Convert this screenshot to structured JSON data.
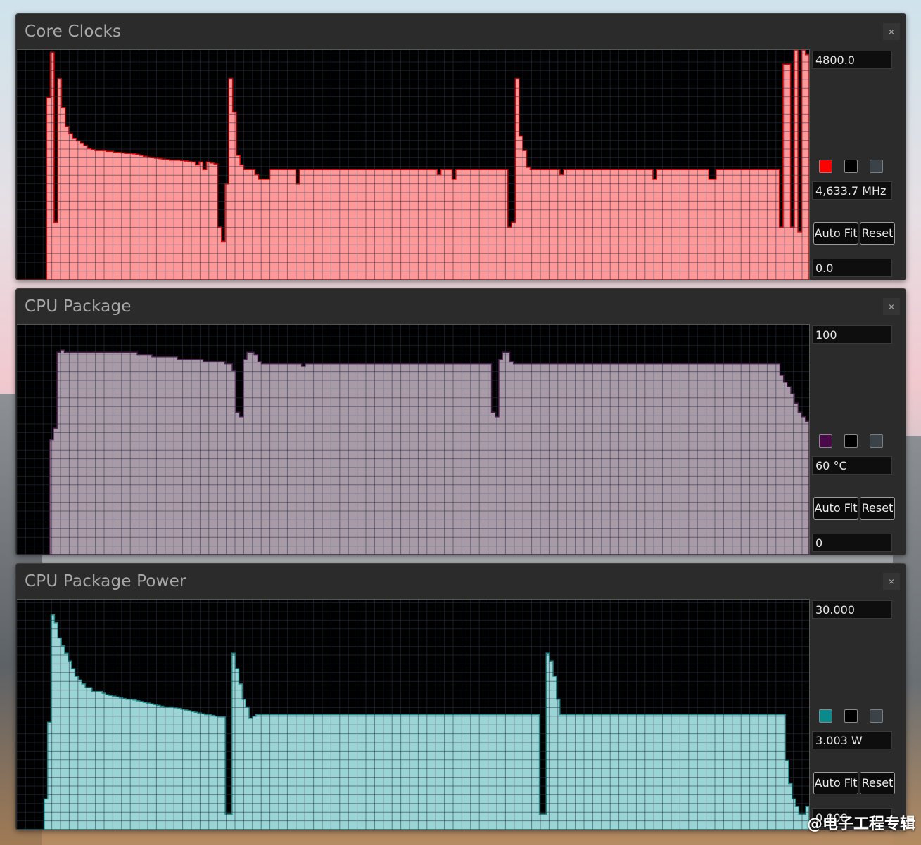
{
  "panels": [
    {
      "title": "Core Clocks",
      "max_label": "4800.0",
      "current": "4,633.7 MHz",
      "min_label": "0.0",
      "auto_fit": "Auto Fit",
      "reset": "Reset",
      "close": "×",
      "swatch_color": "#ff0000",
      "fill_color": "#ff9898",
      "stroke_color": "#d80000",
      "chart_data": {
        "type": "area",
        "ylim": [
          0,
          4800
        ],
        "values": [
          0,
          0,
          0,
          0,
          0,
          0,
          0,
          0,
          3800,
          4750,
          1200,
          4200,
          3600,
          3200,
          3050,
          2950,
          2900,
          2850,
          2800,
          2750,
          2720,
          2700,
          2700,
          2700,
          2680,
          2680,
          2660,
          2660,
          2650,
          2640,
          2640,
          2630,
          2620,
          2600,
          2580,
          2560,
          2550,
          2540,
          2530,
          2520,
          2510,
          2500,
          2500,
          2500,
          2490,
          2480,
          2470,
          2460,
          2400,
          2460,
          2300,
          2460,
          2440,
          2420,
          1100,
          800,
          2000,
          4200,
          3500,
          2600,
          2400,
          2300,
          2300,
          2300,
          2200,
          2100,
          2100,
          2100,
          2300,
          2300,
          2300,
          2300,
          2300,
          2300,
          2300,
          2000,
          2300,
          2300,
          2300,
          2300,
          2300,
          2300,
          2300,
          2300,
          2300,
          2300,
          2300,
          2300,
          2300,
          2300,
          2300,
          2300,
          2300,
          2300,
          2300,
          2300,
          2300,
          2300,
          2300,
          2300,
          2300,
          2300,
          2300,
          2300,
          2300,
          2300,
          2300,
          2300,
          2300,
          2300,
          2300,
          2300,
          2300,
          2200,
          2300,
          2300,
          2300,
          2100,
          2300,
          2300,
          2300,
          2300,
          2300,
          2300,
          2300,
          2300,
          2300,
          2300,
          2300,
          2300,
          2300,
          2300,
          1100,
          1200,
          4200,
          3000,
          2700,
          2350,
          2300,
          2300,
          2300,
          2300,
          2300,
          2300,
          2300,
          2300,
          2200,
          2300,
          2300,
          2300,
          2300,
          2300,
          2300,
          2300,
          2300,
          2300,
          2300,
          2300,
          2300,
          2300,
          2300,
          2300,
          2300,
          2300,
          2300,
          2300,
          2300,
          2300,
          2300,
          2300,
          2300,
          2100,
          2300,
          2300,
          2300,
          2300,
          2300,
          2300,
          2300,
          2300,
          2300,
          2300,
          2300,
          2300,
          2300,
          2300,
          2100,
          2100,
          2300,
          2300,
          2300,
          2300,
          2300,
          2300,
          2300,
          2300,
          2300,
          2300,
          2300,
          2300,
          2300,
          2300,
          2300,
          2300,
          2300,
          1100,
          4500,
          4500,
          1100,
          4800,
          1000,
          4800,
          4700
        ]
      }
    },
    {
      "title": "CPU Package",
      "max_label": "100",
      "current": "60 °C",
      "min_label": "0",
      "auto_fit": "Auto Fit",
      "reset": "Reset",
      "close": "×",
      "swatch_color": "#4a0a4a",
      "fill_color": "#a99aa8",
      "stroke_color": "#4a1a4a",
      "chart_data": {
        "type": "area",
        "ylim": [
          0,
          100
        ],
        "values": [
          0,
          0,
          0,
          0,
          0,
          0,
          0,
          0,
          0,
          50,
          55,
          88,
          89,
          88,
          88,
          88,
          88,
          88,
          88,
          88,
          88,
          88,
          88,
          88,
          88,
          88,
          88,
          88,
          88,
          88,
          88,
          88,
          88,
          87,
          87,
          87,
          87,
          86,
          86,
          86,
          86,
          86,
          86,
          86,
          85,
          85,
          85,
          85,
          85,
          85,
          85,
          84,
          84,
          84,
          84,
          84,
          84,
          83,
          83,
          80,
          62,
          60,
          85,
          88,
          88,
          87,
          84,
          83,
          83,
          83,
          83,
          83,
          83,
          83,
          83,
          83,
          83,
          83,
          82,
          83,
          83,
          83,
          83,
          83,
          83,
          83,
          83,
          83,
          83,
          83,
          83,
          83,
          83,
          83,
          83,
          83,
          83,
          83,
          83,
          83,
          83,
          83,
          83,
          83,
          83,
          83,
          83,
          83,
          83,
          83,
          83,
          83,
          83,
          83,
          83,
          83,
          83,
          83,
          83,
          83,
          83,
          83,
          83,
          83,
          83,
          83,
          83,
          83,
          83,
          83,
          62,
          60,
          85,
          88,
          88,
          84,
          83,
          83,
          83,
          83,
          83,
          83,
          83,
          83,
          83,
          83,
          83,
          83,
          83,
          83,
          83,
          83,
          83,
          83,
          83,
          83,
          83,
          83,
          83,
          83,
          83,
          83,
          83,
          83,
          83,
          83,
          83,
          83,
          83,
          83,
          83,
          83,
          83,
          83,
          83,
          83,
          83,
          83,
          83,
          83,
          83,
          83,
          83,
          83,
          83,
          83,
          83,
          83,
          83,
          83,
          83,
          83,
          83,
          83,
          83,
          83,
          83,
          83,
          83,
          83,
          83,
          83,
          83,
          83,
          83,
          83,
          83,
          83,
          83,
          78,
          75,
          73,
          70,
          66,
          62,
          60,
          58
        ]
      }
    },
    {
      "title": "CPU Package Power",
      "max_label": "30.000",
      "current": "3.003 W",
      "min_label": "0.000",
      "auto_fit": "Auto Fit",
      "reset": "Reset",
      "close": "×",
      "swatch_color": "#0a8a8a",
      "fill_color": "#9ad4d4",
      "stroke_color": "#1a8a8a",
      "chart_data": {
        "type": "area",
        "ylim": [
          0,
          30
        ],
        "values": [
          0,
          0,
          0,
          0,
          0,
          0,
          0,
          0,
          4,
          14,
          28,
          27,
          25,
          24,
          23,
          22,
          21,
          20,
          19.5,
          19,
          18.5,
          18.5,
          18,
          18,
          18,
          17.8,
          17.6,
          17.5,
          17.4,
          17.3,
          17.2,
          17.1,
          17,
          17,
          16.9,
          16.8,
          16.7,
          16.6,
          16.5,
          16.4,
          16.3,
          16.2,
          16.1,
          16,
          16,
          16,
          15.9,
          15.8,
          15.7,
          15.6,
          15.5,
          15.4,
          15.3,
          15.2,
          15.1,
          15,
          15,
          14.9,
          14.8,
          14.7,
          14.7,
          2,
          2,
          23,
          21,
          19,
          17,
          16,
          14.5,
          14.8,
          15,
          15,
          15,
          15,
          15,
          15,
          15,
          15,
          15,
          15,
          15,
          15,
          15,
          15,
          15,
          15,
          15,
          15,
          15,
          15,
          15,
          15,
          15,
          15,
          15,
          15,
          15,
          15,
          15,
          15,
          15,
          15,
          15,
          15,
          15,
          15,
          15,
          15,
          15,
          15,
          15,
          15,
          15,
          15,
          15,
          15,
          15,
          15,
          15,
          15,
          15,
          15,
          15,
          15,
          15,
          15,
          15,
          15,
          15,
          15,
          15,
          15,
          15,
          15,
          15,
          15,
          15,
          15,
          15,
          15,
          15,
          15,
          15,
          15,
          15,
          15,
          15,
          15,
          15,
          15,
          15,
          15,
          15,
          2,
          2,
          23,
          22,
          20,
          17,
          15,
          15,
          15,
          15,
          15,
          15,
          15,
          15,
          15,
          15,
          15,
          15,
          15,
          15,
          15,
          15,
          15,
          15,
          15,
          15,
          15,
          15,
          15,
          15,
          15,
          15,
          15,
          15,
          15,
          15,
          15,
          15,
          15,
          15,
          15,
          15,
          15,
          15,
          15,
          15,
          15,
          15,
          15,
          15,
          15,
          15,
          15,
          15,
          15,
          15,
          15,
          15,
          15,
          15,
          15,
          15,
          15,
          15,
          15,
          15,
          15,
          15,
          15,
          15,
          15,
          15,
          9,
          6,
          4,
          3,
          2,
          2,
          3
        ]
      }
    }
  ],
  "watermark": "@电子工程专辑"
}
